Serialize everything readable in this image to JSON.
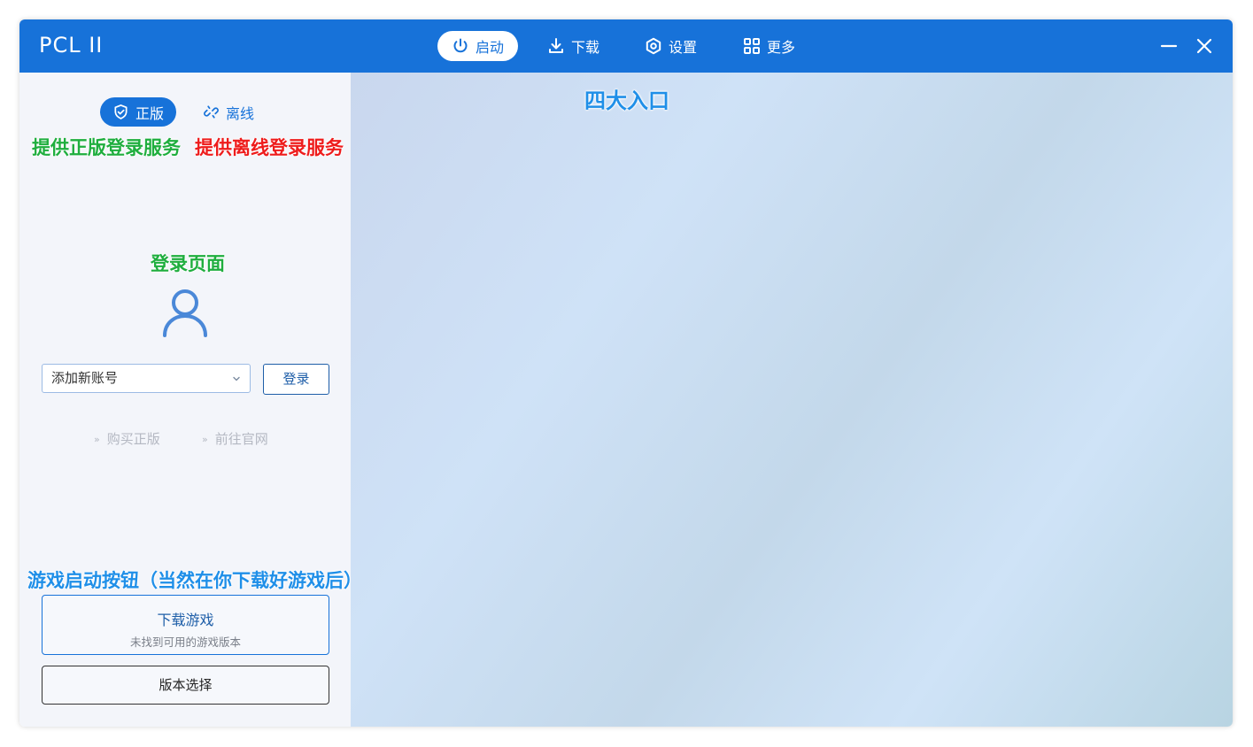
{
  "titlebar": {
    "app_title": "PCL II",
    "nav": [
      {
        "label": "启动",
        "icon": "power-icon",
        "active": true
      },
      {
        "label": "下载",
        "icon": "download-icon",
        "active": false
      },
      {
        "label": "设置",
        "icon": "gear-icon",
        "active": false
      },
      {
        "label": "更多",
        "icon": "grid-icon",
        "active": false
      }
    ],
    "window_controls": [
      "minimize-icon",
      "close-icon"
    ]
  },
  "sidebar": {
    "tabs": [
      {
        "label": "正版",
        "icon": "shield-check-icon",
        "active": true
      },
      {
        "label": "离线",
        "icon": "link-broken-icon",
        "active": false
      }
    ],
    "account_select": {
      "value": "添加新账号"
    },
    "login_button": "登录",
    "links": [
      {
        "label": "购买正版"
      },
      {
        "label": "前往官网"
      }
    ],
    "launch_button": {
      "title": "下载游戏",
      "subtitle": "未找到可用的游戏版本"
    },
    "version_button": "版本选择",
    "avatar_icon": "user-icon"
  },
  "annotations": {
    "official_login": "提供正版登录服务",
    "offline_login": "提供离线登录服务",
    "login_page": "登录页面",
    "four_entries": "四大入口",
    "launch_button": "游戏启动按钮（当然在你下载好游戏后）"
  },
  "colors": {
    "accent": "#1772d9",
    "annotation_green": "#1fae3e",
    "annotation_red": "#ee1c1c",
    "annotation_blue": "#1f8fe8"
  }
}
